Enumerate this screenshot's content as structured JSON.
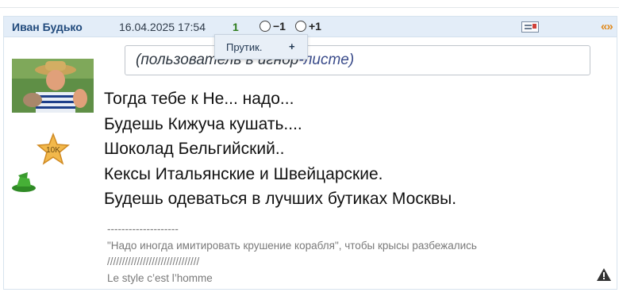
{
  "header": {
    "author": "Иван Будько",
    "date": "16.04.2025 17:54",
    "rating": "1",
    "vote_minus": "−1",
    "vote_plus": "+1",
    "quote_symbol": "«»"
  },
  "ignore_notice": {
    "prefix": "(пользователь в ",
    "middle": "игнор",
    "suffix": "-листе)"
  },
  "popup": {
    "item_label": "Прутик.",
    "add_label": "+"
  },
  "sidebar": {
    "badge_text": "10K"
  },
  "message_lines": [
    "Тогда тебе к Не... надо...",
    "Будешь Кижуча кушать....",
    "Шоколад Бельгийский..",
    "Кексы Итальянские и Швейцарские.",
    "Будешь одеваться в лучших бутиках Москвы."
  ],
  "signature": {
    "divider": "--------------------",
    "quote": "\"Надо иногда имитировать крушение корабля\", чтобы крысы разбежались",
    "slashes": "///////////////////////////////",
    "motto": "Le style c’est l’homme"
  },
  "colors": {
    "header_bg": "#e3edf8",
    "author": "#214a7c",
    "rating": "#2e7d1e",
    "quote_icon": "#e08a1e"
  }
}
